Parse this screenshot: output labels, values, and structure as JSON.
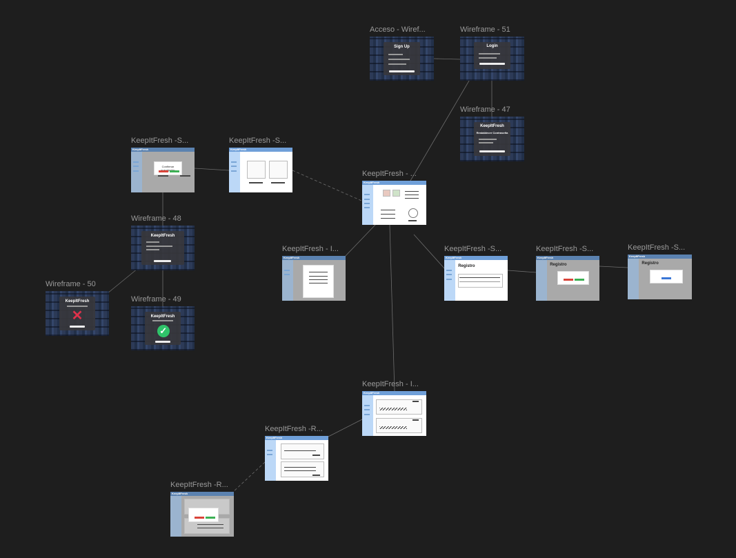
{
  "canvas": {
    "background": "#1e1e1e",
    "accent_light": "#bcd8f7",
    "accent_dark": "#1a2336"
  },
  "frames": {
    "acceso": {
      "title": "Acceso - Wiref...",
      "panel_title": "Sign Up"
    },
    "wf51": {
      "title": "Wireframe - 51",
      "panel_title": "Login"
    },
    "wf47": {
      "title": "Wireframe - 47",
      "brand": "KeepItFresh",
      "panel_title": "Restablecer Contraseña"
    },
    "kf_s1": {
      "title": "KeepItFresh -S...",
      "brand": "KeepItFresh",
      "modal_title": "Confirmar suscripción"
    },
    "kf_s2": {
      "title": "KeepItFresh -S...",
      "brand": "KeepItFresh"
    },
    "kf_main": {
      "title": "KeepItFresh - ...",
      "brand": "KeepItFresh"
    },
    "wf48": {
      "title": "Wireframe - 48",
      "panel_title": "KeepItFresh"
    },
    "wf50": {
      "title": "Wireframe - 50",
      "panel_title": "KeepItFresh",
      "mark": "✕"
    },
    "wf49": {
      "title": "Wireframe - 49",
      "panel_title": "KeepItFresh",
      "mark": "✓"
    },
    "kf_i1": {
      "title": "KeepItFresh - I...",
      "brand": "KeepItFresh"
    },
    "kf_s3": {
      "title": "KeepItFresh -S...",
      "brand": "KeepItFresh",
      "heading": "Registro"
    },
    "kf_s4": {
      "title": "KeepItFresh -S...",
      "brand": "KeepItFresh",
      "heading": "Registro"
    },
    "kf_s5": {
      "title": "KeepItFresh -S...",
      "brand": "KeepItFresh",
      "heading": "Registro"
    },
    "kf_i2": {
      "title": "KeepItFresh - I...",
      "brand": "KeepItFresh"
    },
    "kf_r1": {
      "title": "KeepItFresh -R...",
      "brand": "KeepItFresh"
    },
    "kf_r2": {
      "title": "KeepItFresh -R...",
      "brand": "KeepItFresh"
    }
  }
}
